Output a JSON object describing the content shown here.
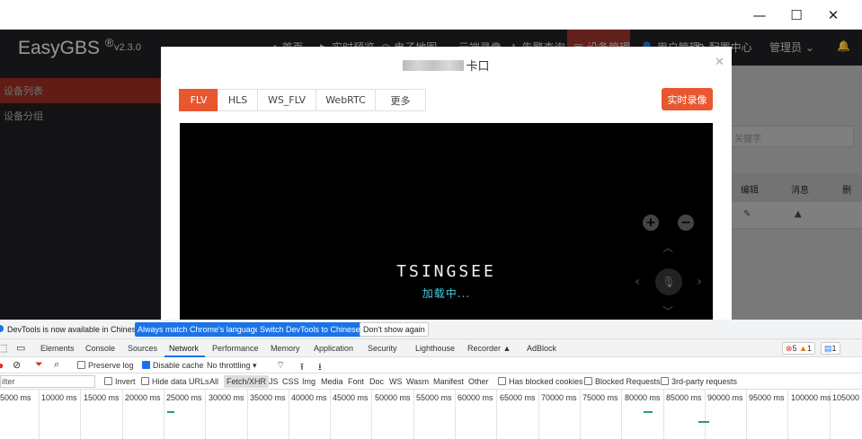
{
  "window": {
    "minimize": "—",
    "maximize": "☐",
    "close": "✕"
  },
  "app": {
    "logo": "EasyGBS",
    "logo_reg": "®",
    "version": "v2.3.0",
    "nav": [
      "首页",
      "实时预览",
      "电子地图",
      "云端录像",
      "告警查询",
      "设备管理",
      "用户管理",
      "配置中心"
    ],
    "user": "管理员",
    "sidebar": [
      "设备列表",
      "设备分组"
    ],
    "search_placeholder": "关键字",
    "table_headers": [
      "编辑",
      "消息",
      "删"
    ]
  },
  "modal": {
    "title_suffix": "卡口",
    "tabs": [
      "FLV",
      "HLS",
      "WS_FLV",
      "WebRTC",
      "更多"
    ],
    "active_tab": "FLV",
    "record_button": "实时录像",
    "brand": "TSINGSEE",
    "loading": "加载中...",
    "accent": "#e8572f"
  },
  "devtools": {
    "banner_text": "DevTools is now available in Chinese!",
    "banner_btn1": "Always match Chrome's language",
    "banner_btn2": "Switch DevTools to Chinese",
    "banner_btn3": "Don't show again",
    "tabs": [
      "Elements",
      "Console",
      "Sources",
      "Network",
      "Performance",
      "Memory",
      "Application",
      "Security",
      "Lighthouse",
      "Recorder",
      "AdBlock"
    ],
    "active_tab": "Network",
    "errors": "5",
    "warnings": "1",
    "messages": "1",
    "toolbar": {
      "preserve_log": "Preserve log",
      "disable_cache": "Disable cache",
      "throttling": "No throttling"
    },
    "filter": {
      "placeholder": "ilter",
      "invert": "Invert",
      "hide_data_urls": "Hide data URLs",
      "types": [
        "All",
        "Fetch/XHR",
        "JS",
        "CSS",
        "Img",
        "Media",
        "Font",
        "Doc",
        "WS",
        "Wasm",
        "Manifest",
        "Other"
      ],
      "active_type": "Fetch/XHR",
      "blocked_cookies": "Has blocked cookies",
      "blocked_requests": "Blocked Requests",
      "third_party": "3rd-party requests"
    },
    "timeline_ticks": [
      "5000 ms",
      "10000 ms",
      "15000 ms",
      "20000 ms",
      "25000 ms",
      "30000 ms",
      "35000 ms",
      "40000 ms",
      "45000 ms",
      "50000 ms",
      "55000 ms",
      "60000 ms",
      "65000 ms",
      "70000 ms",
      "75000 ms",
      "80000 ms",
      "85000 ms",
      "90000 ms",
      "95000 ms",
      "100000 ms",
      "105000"
    ]
  }
}
